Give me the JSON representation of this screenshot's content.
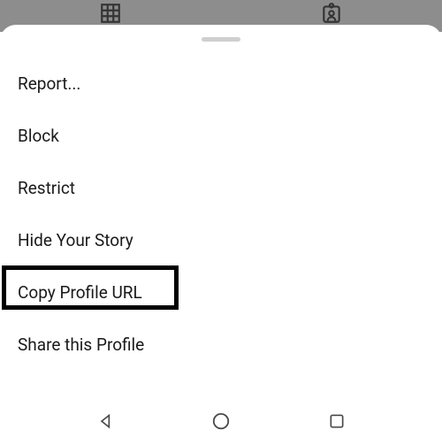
{
  "backgroundTabs": {
    "gridIcon": "grid-icon",
    "taggedIcon": "tagged-icon"
  },
  "sheet": {
    "items": [
      {
        "label": "Report..."
      },
      {
        "label": "Block"
      },
      {
        "label": "Restrict"
      },
      {
        "label": "Hide Your Story"
      },
      {
        "label": "Copy Profile URL"
      },
      {
        "label": "Share this Profile"
      }
    ],
    "highlightedIndex": 4
  },
  "nav": {
    "back": "back-icon",
    "home": "home-icon",
    "recent": "recent-icon"
  }
}
